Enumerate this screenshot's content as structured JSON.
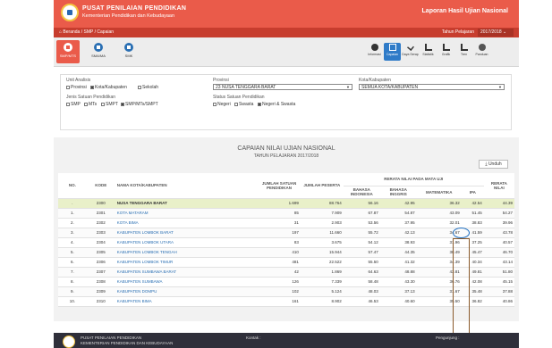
{
  "header": {
    "org_name": "PUSAT PENILAIAN PENDIDIKAN",
    "org_sub": "Kementerian Pendidikan dan Kebudayaan",
    "app_title": "Laporan Hasil Ujian Nasional"
  },
  "crumb": {
    "path": "⌂ Beranda / SMP / Capaian",
    "year_label": "Tahun Pelajaran",
    "year_value": "2017/2018"
  },
  "levels": [
    {
      "label": "SMP/MTS",
      "active": true
    },
    {
      "label": "SMA/MA",
      "active": false
    },
    {
      "label": "SMK",
      "active": false
    }
  ],
  "tools": [
    {
      "label": "Informasi",
      "icon": "info-icon"
    },
    {
      "label": "Capaian",
      "icon": "book-icon",
      "active": true
    },
    {
      "label": "Daya Serap",
      "icon": "check-icon"
    },
    {
      "label": "Statistik",
      "icon": "bar-chart-icon"
    },
    {
      "label": "Grafik",
      "icon": "gear-icon"
    },
    {
      "label": "Tren",
      "icon": "trend-icon"
    },
    {
      "label": "Panduan",
      "icon": "help-icon"
    }
  ],
  "filters": {
    "unit_label": "Unit Analisis",
    "unit_opts": [
      "Provinsi",
      "Kota/Kabupaten",
      "Sekolah"
    ],
    "jenis_label": "Jenis Satuan Pendidikan",
    "jenis_opts": [
      "SMP",
      "MTs",
      "SMPT",
      "SMP/MTs/SMPT"
    ],
    "provinsi_label": "Provinsi",
    "provinsi_value": "23 NUSA TENGGARA BARAT",
    "status_label": "Status Satuan Pendidikan",
    "status_opts": [
      "Negeri",
      "Swasta",
      "Negeri & Swasta"
    ],
    "kota_label": "Kota/Kabupaten",
    "kota_value": "SEMUA KOTA/KABUPATEN"
  },
  "report": {
    "title": "CAPAIAN NILAI UJIAN NASIONAL",
    "subtitle": "TAHUN PELAJARAN 2017/2018",
    "download": "Unduh"
  },
  "table": {
    "h_no": "NO.",
    "h_kode": "KODE",
    "h_nama": "NAMA KOTA/KABUPATEN",
    "h_satuan": "JUMLAH SATUAN PENDIDIKAN",
    "h_peserta": "JUMLAH PESERTA",
    "h_rerata_mapel": "RERATA NILAI PADA MATA UJI",
    "h_bind": "BAHASA INDONESIA",
    "h_bing": "BAHASA INGGRIS",
    "h_mat": "MATEMATIKA",
    "h_ipa": "IPA",
    "h_rerata": "RERATA NILAI",
    "rows": [
      {
        "no": ".",
        "kode": "2300",
        "nama": "NUSA TENGGARA BARAT",
        "satuan": "1.699",
        "peserta": "88.764",
        "bind": "56.16",
        "bing": "42.95",
        "mat": "36.32",
        "ipa": "42.54",
        "rerata": "44.39",
        "prov": true
      },
      {
        "no": "1.",
        "kode": "2301",
        "nama": "KOTA MATARAM",
        "satuan": "85",
        "peserta": "7.909",
        "bind": "67.87",
        "bing": "54.87",
        "mat": "43.09",
        "ipa": "51.45",
        "rerata": "54.27"
      },
      {
        "no": "2.",
        "kode": "2302",
        "nama": "KOTA BIMA",
        "satuan": "31",
        "peserta": "2.903",
        "bind": "53.56",
        "bing": "37.95",
        "mat": "32.01",
        "ipa": "38.83",
        "rerata": "39.96"
      },
      {
        "no": "3.",
        "kode": "2303",
        "nama": "KABUPATEN LOMBOK BARAT",
        "satuan": "197",
        "peserta": "11.660",
        "bind": "55.72",
        "bing": "42.13",
        "mat": "34.67",
        "ipa": "41.59",
        "rerata": "43.78"
      },
      {
        "no": "4.",
        "kode": "2304",
        "nama": "KABUPATEN LOMBOK UTARA",
        "satuan": "83",
        "peserta": "3.675",
        "bind": "54.12",
        "bing": "38.93",
        "mat": "31.96",
        "ipa": "37.25",
        "rerata": "40.57"
      },
      {
        "no": "5.",
        "kode": "2305",
        "nama": "KABUPATEN LOMBOK TENGAH",
        "satuan": "410",
        "peserta": "15.944",
        "bind": "57.47",
        "bing": "44.35",
        "mat": "38.49",
        "ipa": "45.47",
        "rerata": "46.70"
      },
      {
        "no": "6.",
        "kode": "2306",
        "nama": "KABUPATEN LOMBOK TIMUR",
        "satuan": "481",
        "peserta": "22.522",
        "bind": "55.50",
        "bing": "41.32",
        "mat": "34.39",
        "ipa": "40.34",
        "rerata": "43.14"
      },
      {
        "no": "7.",
        "kode": "2307",
        "nama": "KABUPATEN SUMBAWA BARAT",
        "satuan": "42",
        "peserta": "1.869",
        "bind": "64.63",
        "bing": "48.88",
        "mat": "43.81",
        "ipa": "49.81",
        "rerata": "51.80"
      },
      {
        "no": "8.",
        "kode": "2308",
        "nama": "KABUPATEN SUMBAWA",
        "satuan": "126",
        "peserta": "7.339",
        "bind": "58.48",
        "bing": "43.30",
        "mat": "36.76",
        "ipa": "42.08",
        "rerata": "45.15"
      },
      {
        "no": "9.",
        "kode": "2309",
        "nama": "KABUPATEN DOMPU",
        "satuan": "102",
        "peserta": "5.124",
        "bind": "48.03",
        "bing": "37.13",
        "mat": "31.67",
        "ipa": "35.48",
        "rerata": "37.88"
      },
      {
        "no": "10.",
        "kode": "2310",
        "nama": "KABUPATEN BIMA",
        "satuan": "161",
        "peserta": "8.902",
        "bind": "46.53",
        "bing": "40.60",
        "mat": "35.50",
        "ipa": "36.82",
        "rerata": "40.86"
      }
    ]
  },
  "footer": {
    "org_name": "PUSAT PENILAIAN PENDIDIKAN",
    "org_sub": "KEMENTERIAN PENDIDIKAN DAN KEBUDAYAAN",
    "contact": "Kontak :",
    "visitors": "Pengunjung :"
  },
  "colors": {
    "brand_red": "#ea5b4a",
    "crumb_red": "#c73d2e",
    "link_blue": "#2a6fb3",
    "ipa_highlight_oval": "#1f6fc0",
    "ipa_highlight_box": "#8a5a2b"
  }
}
